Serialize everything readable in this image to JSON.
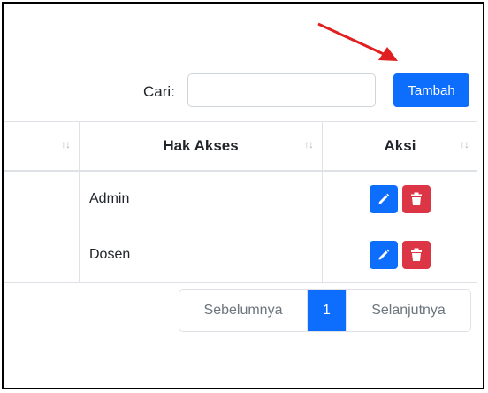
{
  "search": {
    "label": "Cari:",
    "value": "",
    "placeholder": ""
  },
  "toolbar": {
    "add_label": "Tambah"
  },
  "table": {
    "columns": [
      {
        "label": ""
      },
      {
        "label": "Hak Akses"
      },
      {
        "label": "Aksi"
      }
    ],
    "sort_icon": "↑↓",
    "rows": [
      {
        "role": "Admin"
      },
      {
        "role": "Dosen"
      }
    ]
  },
  "pagination": {
    "prev": "Sebelumnya",
    "current": "1",
    "next": "Selanjutnya"
  },
  "icons": {
    "edit": "pencil-icon",
    "delete": "trash-icon"
  },
  "colors": {
    "primary": "#0d6efd",
    "danger": "#dc3545",
    "annotation_arrow": "#e02020"
  }
}
